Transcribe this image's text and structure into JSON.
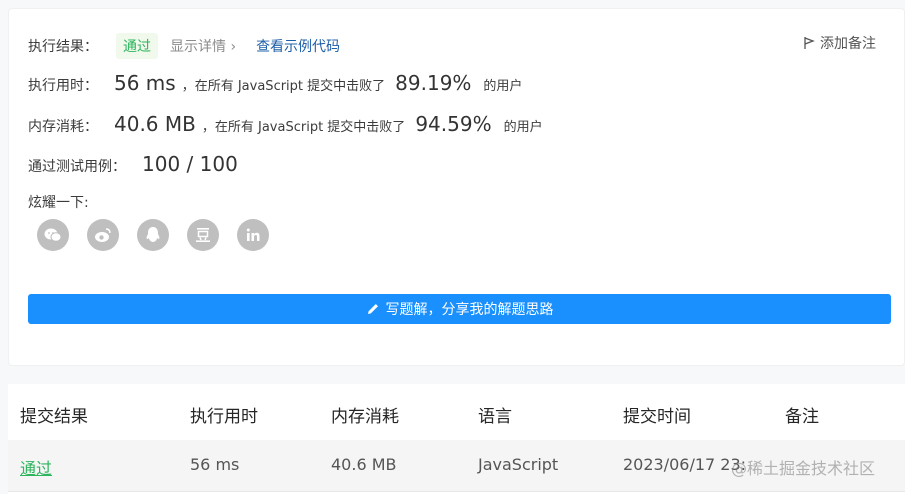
{
  "result": {
    "label": "执行结果：",
    "status": "通过",
    "detail_link": "显示详情 ›",
    "sample_link": "查看示例代码",
    "note_button": "添加备注"
  },
  "runtime": {
    "label": "执行用时：",
    "value": "56 ms",
    "mid_text": "，在所有 JavaScript 提交中击败了",
    "percent": "89.19%",
    "tail_text": "的用户"
  },
  "memory": {
    "label": "内存消耗：",
    "value": "40.6 MB",
    "mid_text": "，在所有 JavaScript 提交中击败了",
    "percent": "94.59%",
    "tail_text": "的用户"
  },
  "tests": {
    "label": "通过测试用例：",
    "value": "100 / 100"
  },
  "share": {
    "label": "炫耀一下:",
    "icons": [
      "wechat-icon",
      "weibo-icon",
      "qq-icon",
      "douban-icon",
      "linkedin-icon"
    ]
  },
  "write_button": "写题解，分享我的解题思路",
  "table": {
    "headers": [
      "提交结果",
      "执行用时",
      "内存消耗",
      "语言",
      "提交时间",
      "备注"
    ],
    "rows": [
      {
        "status": "通过",
        "runtime": "56 ms",
        "memory": "40.6 MB",
        "language": "JavaScript",
        "time": "2023/06/17 23:",
        "note": ""
      }
    ]
  },
  "watermark": "@稀土掘金技术社区",
  "colors": {
    "accent": "#1a90ff",
    "pass": "#2db55d",
    "link": "#1f5fa8"
  }
}
